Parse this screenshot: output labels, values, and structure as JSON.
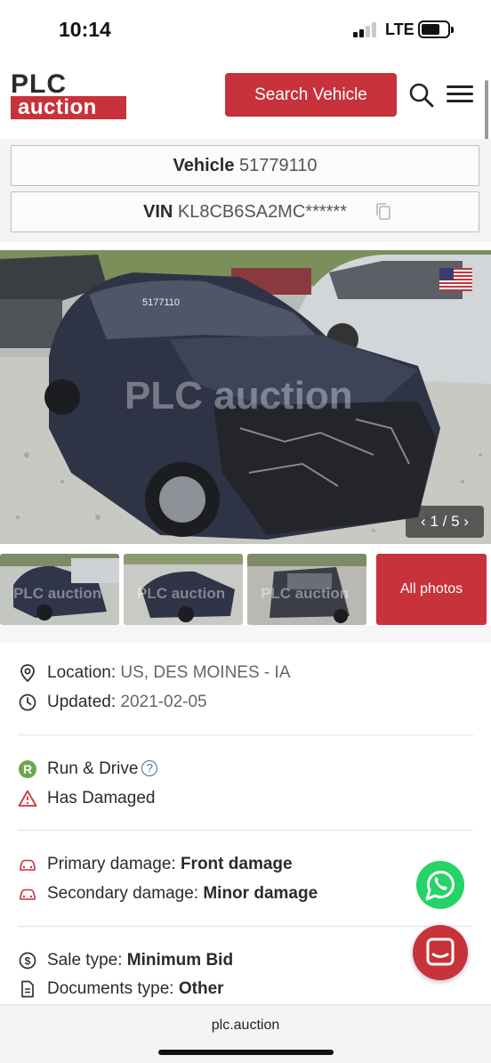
{
  "status_bar": {
    "time": "10:14",
    "network": "LTE"
  },
  "header": {
    "logo_top": "PLC",
    "logo_bottom": "auction",
    "search_button": "Search Vehicle"
  },
  "vehicle": {
    "lot_label": "Vehicle",
    "lot_number": "51779110",
    "vin_label": "VIN",
    "vin_value": "KL8CB6SA2MC******"
  },
  "gallery": {
    "watermark": "PLC auction",
    "page_indicator": "1 / 5",
    "all_photos_label": "All photos",
    "photo_plate_text": "5177110"
  },
  "details": {
    "location_label": "Location:",
    "location_value": "US, DES MOINES - IA",
    "updated_label": "Updated:",
    "updated_value": "2021-02-05",
    "run_drive": "Run & Drive",
    "run_drive_badge": "R",
    "help_mark": "?",
    "has_damaged": "Has Damaged",
    "primary_damage_label": "Primary damage:",
    "primary_damage_value": "Front damage",
    "secondary_damage_label": "Secondary damage:",
    "secondary_damage_value": "Minor damage",
    "sale_type_label": "Sale type:",
    "sale_type_value": "Minimum Bid",
    "documents_label": "Documents type:",
    "documents_value": "Other"
  },
  "browser": {
    "url": "plc.auction"
  },
  "colors": {
    "brand_red": "#c8323a",
    "run_drive_green": "#6aa84f",
    "whatsapp_green": "#25d366"
  }
}
